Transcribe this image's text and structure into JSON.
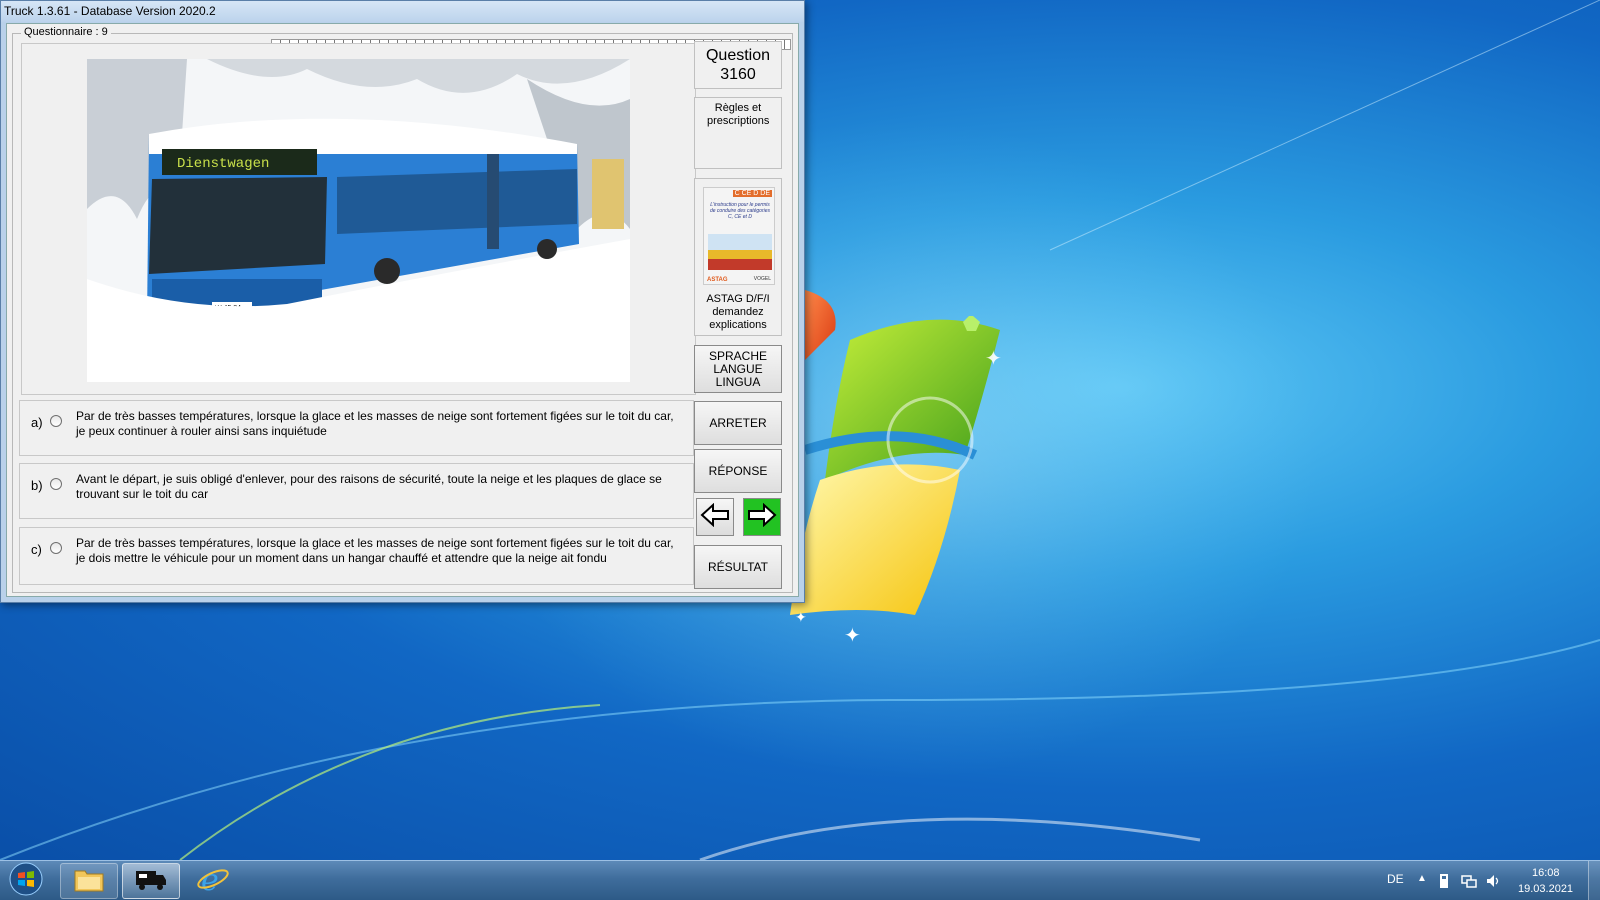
{
  "window": {
    "title": "Truck 1.3.61 - Database Version 2020.2"
  },
  "questionnaire": {
    "label": "Questionnaire : 9"
  },
  "question": {
    "title_line1": "Question",
    "number": "3160"
  },
  "category": {
    "label": "Règles et prescriptions"
  },
  "book": {
    "caption_line1": "ASTAG D/F/I",
    "caption_line2": "demandez",
    "caption_line3": "explications",
    "cover_badges": "C CE D DE",
    "cover_text": "L'instruction pour le permis de conduire des catégories C, CE et D",
    "cover_logo": "ASTAG",
    "cover_publisher": "VOGEL"
  },
  "photo": {
    "bus_sign": "Dienstwagen",
    "plate": "W 45 84"
  },
  "answers": [
    {
      "letter": "a)",
      "text": "Par de très basses températures, lorsque la glace et les masses de neige sont fortement figées sur le toit du car, je peux continuer à rouler ainsi sans inquiétude"
    },
    {
      "letter": "b)",
      "text": "Avant le départ, je suis obligé d'enlever, pour des raisons de sécurité, toute la neige et les plaques de glace se trouvant sur le toit du car"
    },
    {
      "letter": "c)",
      "text": "Par de très basses températures, lorsque la glace et les masses de neige sont fortement figées sur le toit du car, je dois mettre le véhicule pour un moment dans un hangar chauffé et attendre que la neige ait fondu"
    }
  ],
  "buttons": {
    "language_line1": "SPRACHE",
    "language_line2": "LANGUE",
    "language_line3": "LINGUA",
    "stop": "ARRETER",
    "answer": "RÉPONSE",
    "result": "RÉSULTAT"
  },
  "taskbar": {
    "language": "DE",
    "time": "16:08",
    "date": "19.03.2021"
  },
  "colors": {
    "next_button": "#22c222",
    "desktop": "#1167c4"
  }
}
